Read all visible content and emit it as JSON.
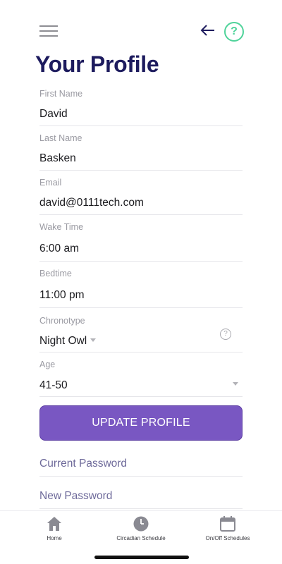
{
  "header": {
    "menu_icon": "hamburger-icon",
    "back_icon": "arrow-left-icon",
    "help_icon": "question-circle-icon",
    "help_glyph": "?",
    "accent_color": "#4fd39a"
  },
  "page_title": "Your Profile",
  "form": {
    "first_name": {
      "label": "First Name",
      "value": "David"
    },
    "last_name": {
      "label": "Last Name",
      "value": "Basken"
    },
    "email": {
      "label": "Email",
      "value": "david@0111tech.com"
    },
    "wake_time": {
      "label": "Wake Time",
      "value": "6:00 am"
    },
    "bedtime": {
      "label": "Bedtime",
      "value": "11:00 pm"
    },
    "chronotype": {
      "label": "Chronotype",
      "value": "Night Owl",
      "help_glyph": "?"
    },
    "age": {
      "label": "Age",
      "value": "41-50"
    }
  },
  "update_button": {
    "label": "UPDATE PROFILE",
    "color": "#7957c2"
  },
  "password": {
    "current_placeholder": "Current Password",
    "new_placeholder": "New Password"
  },
  "tabbar": {
    "items": [
      {
        "label": "Home",
        "icon": "home-icon"
      },
      {
        "label": "Circadian Schedule",
        "icon": "clock-icon"
      },
      {
        "label": "On/Off Schedules",
        "icon": "calendar-icon"
      }
    ]
  },
  "colors": {
    "title": "#1d1b5e",
    "primary": "#7957c2",
    "placeholder": "#6e6a9a"
  }
}
